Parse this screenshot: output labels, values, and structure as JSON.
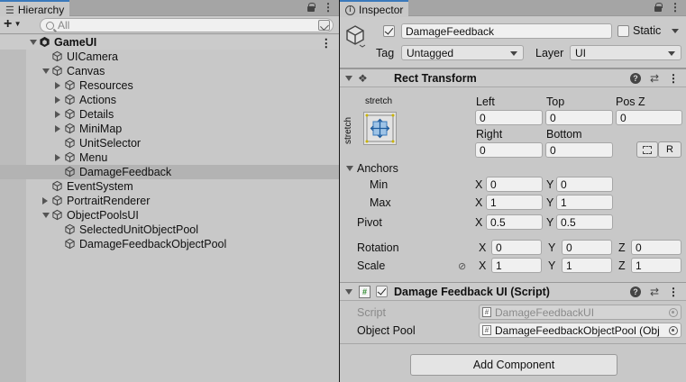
{
  "hierarchy": {
    "tab_label": "Hierarchy",
    "add_label": "+",
    "search_placeholder": "All",
    "rows": [
      {
        "label": "GameUI",
        "indent": 0,
        "arrow": "down",
        "icon": "unity-scene-icon",
        "bold": true
      },
      {
        "label": "UICamera",
        "indent": 1,
        "arrow": "none",
        "icon": "gameobject-icon"
      },
      {
        "label": "Canvas",
        "indent": 1,
        "arrow": "down",
        "icon": "gameobject-icon"
      },
      {
        "label": "Resources",
        "indent": 2,
        "arrow": "right",
        "icon": "gameobject-icon"
      },
      {
        "label": "Actions",
        "indent": 2,
        "arrow": "right",
        "icon": "gameobject-icon"
      },
      {
        "label": "Details",
        "indent": 2,
        "arrow": "right",
        "icon": "gameobject-icon"
      },
      {
        "label": "MiniMap",
        "indent": 2,
        "arrow": "right",
        "icon": "gameobject-icon"
      },
      {
        "label": "UnitSelector",
        "indent": 2,
        "arrow": "none",
        "icon": "gameobject-icon"
      },
      {
        "label": "Menu",
        "indent": 2,
        "arrow": "right",
        "icon": "gameobject-icon"
      },
      {
        "label": "DamageFeedback",
        "indent": 2,
        "arrow": "none",
        "icon": "gameobject-icon",
        "selected": true
      },
      {
        "label": "EventSystem",
        "indent": 1,
        "arrow": "none",
        "icon": "gameobject-icon"
      },
      {
        "label": "PortraitRenderer",
        "indent": 1,
        "arrow": "right",
        "icon": "gameobject-icon"
      },
      {
        "label": "ObjectPoolsUI",
        "indent": 1,
        "arrow": "down",
        "icon": "gameobject-icon"
      },
      {
        "label": "SelectedUnitObjectPool",
        "indent": 2,
        "arrow": "none",
        "icon": "gameobject-icon"
      },
      {
        "label": "DamageFeedbackObjectPool",
        "indent": 2,
        "arrow": "none",
        "icon": "gameobject-icon"
      }
    ]
  },
  "inspector": {
    "tab_label": "Inspector",
    "object_name": "DamageFeedback",
    "active": true,
    "static_label": "Static",
    "tag_label": "Tag",
    "tag_value": "Untagged",
    "layer_label": "Layer",
    "layer_value": "UI",
    "rect_transform": {
      "title": "Rect Transform",
      "anchor_preset_h": "stretch",
      "anchor_preset_v": "stretch",
      "left_label": "Left",
      "left_value": "0",
      "top_label": "Top",
      "top_value": "0",
      "posz_label": "Pos Z",
      "posz_value": "0",
      "right_label": "Right",
      "right_value": "0",
      "bottom_label": "Bottom",
      "bottom_value": "0",
      "raw_button": "R",
      "anchors_label": "Anchors",
      "min_label": "Min",
      "min_x": "0",
      "min_y": "0",
      "max_label": "Max",
      "max_x": "1",
      "max_y": "1",
      "pivot_label": "Pivot",
      "pivot_x": "0.5",
      "pivot_y": "0.5",
      "rotation_label": "Rotation",
      "rot_x": "0",
      "rot_y": "0",
      "rot_z": "0",
      "scale_label": "Scale",
      "scale_x": "1",
      "scale_y": "1",
      "scale_z": "1",
      "x": "X",
      "y": "Y",
      "z": "Z"
    },
    "script_component": {
      "title": "Damage Feedback UI (Script)",
      "enabled": true,
      "script_label": "Script",
      "script_value": "DamageFeedbackUI",
      "pool_label": "Object Pool",
      "pool_value": "DamageFeedbackObjectPool (Obj"
    },
    "add_component_label": "Add Component"
  },
  "colors": {
    "panel_bg": "#c8c8c8",
    "selection": "#b3b3b3",
    "tab_accent": "#3a79bb"
  }
}
